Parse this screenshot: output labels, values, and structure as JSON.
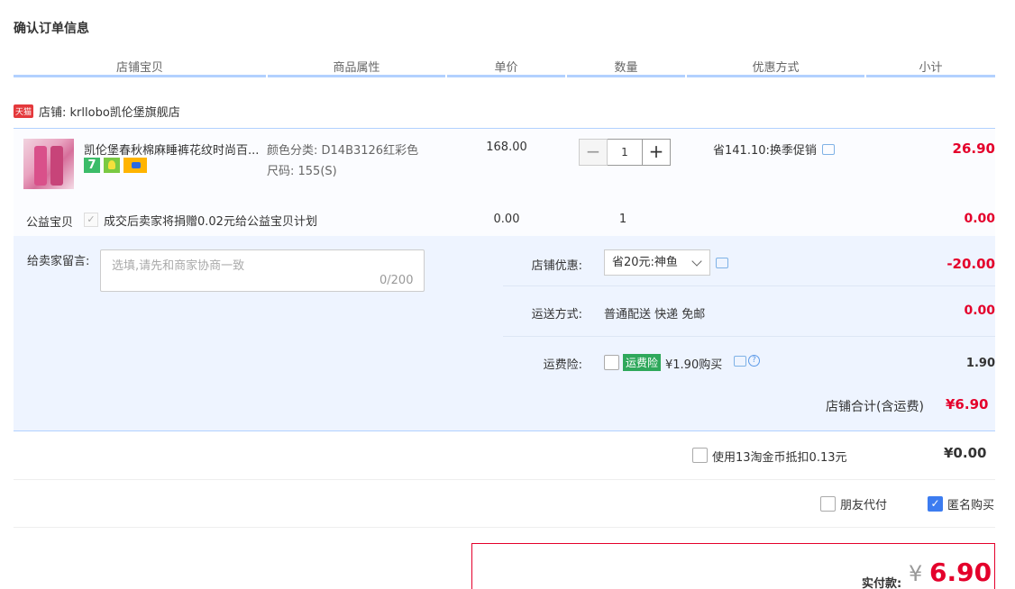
{
  "page": {
    "title": "确认订单信息"
  },
  "columns": [
    "店铺宝贝",
    "商品属性",
    "单价",
    "数量",
    "优惠方式",
    "小计"
  ],
  "shop": {
    "badge": "天猫",
    "label": "店铺: krllobo凯伦堡旗舰店"
  },
  "item": {
    "name": "凯伦堡春秋棉麻睡裤花纹时尚百...",
    "badge_7": "7",
    "attr_color": "颜色分类: D14B3126红彩色",
    "attr_size": "尺码: 155(S)",
    "price": "168.00",
    "quantity": "1",
    "qty_minus": "−",
    "qty_plus": "+",
    "promo": "省141.10:换季促销",
    "subtotal": "26.90"
  },
  "charity": {
    "label": "公益宝贝",
    "check": "✓",
    "text": "成交后卖家将捐赠0.02元给公益宝贝计划",
    "price": "0.00",
    "quantity": "1",
    "subtotal": "0.00"
  },
  "message": {
    "label": "给卖家留言:",
    "placeholder": "选填,请先和商家协商一致",
    "counter": "0/200"
  },
  "shop_discount": {
    "label": "店铺优惠:",
    "selected": "省20元:神鱼",
    "amount": "-20.00"
  },
  "shipping": {
    "label": "运送方式:",
    "text": "普通配送 快递 免邮",
    "amount": "0.00"
  },
  "insurance": {
    "label": "运费险:",
    "tag": "运费险",
    "text": "¥1.90购买",
    "help": "?",
    "amount": "1.90"
  },
  "shop_total": {
    "label": "店铺合计(含运费)",
    "value": "¥6.90"
  },
  "coins": {
    "text": "使用13淘金币抵扣0.13元",
    "value": "¥0.00"
  },
  "options": {
    "friend_pay": "朋友代付",
    "anonymous": "匿名购买",
    "anon_check": "✓"
  },
  "payment": {
    "label": "实付款:",
    "currency": "¥",
    "value": "6.90"
  },
  "colors": {
    "accent_red": "#e4002b",
    "header_line": "#b2d1ff",
    "panel_bg": "#eef4ff",
    "check_blue": "#3c7cf0",
    "insurance_green": "#2fa85b"
  }
}
